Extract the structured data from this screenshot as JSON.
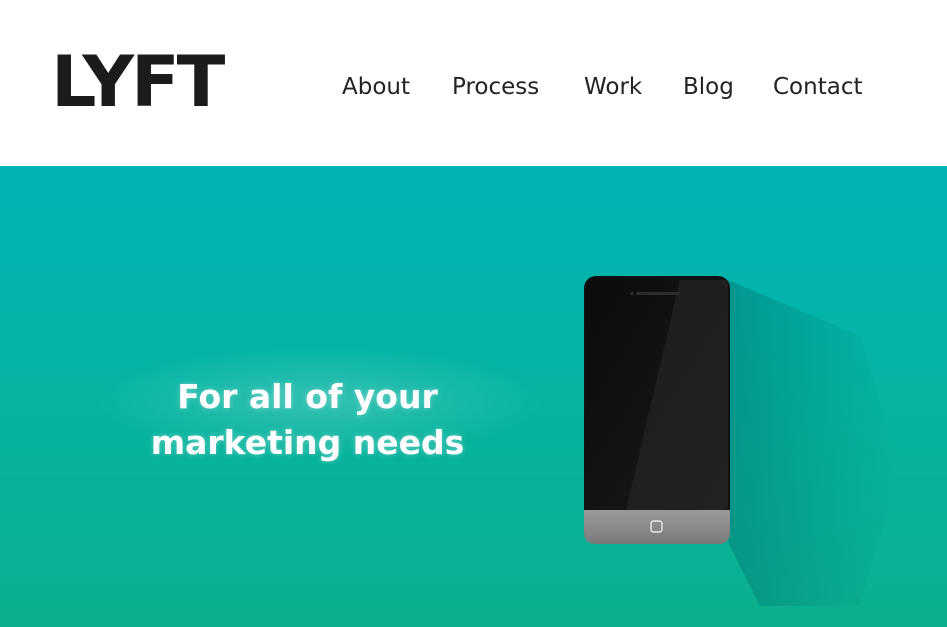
{
  "brand": {
    "logo_text": "LYFT"
  },
  "nav": {
    "items": [
      {
        "label": "About"
      },
      {
        "label": "Process"
      },
      {
        "label": "Work"
      },
      {
        "label": "Blog"
      },
      {
        "label": "Contact"
      }
    ]
  },
  "hero": {
    "headline_line1": "For all of your",
    "headline_line2": "marketing needs",
    "illustration": "smartphone-icon"
  },
  "colors": {
    "hero_gradient_top": "#00b5b5",
    "hero_gradient_bottom": "#0cb08d",
    "text_dark": "#1b1b1b",
    "headline_text": "#ffffff"
  }
}
